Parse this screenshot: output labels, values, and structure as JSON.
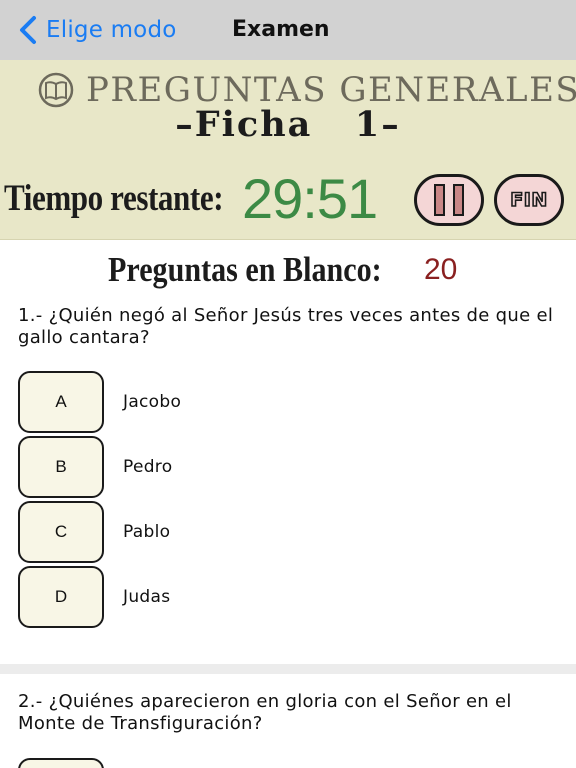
{
  "nav": {
    "back_label": "Elige modo",
    "title": "Examen"
  },
  "header": {
    "section_title": "PREGUNTAS GENERALES",
    "sheet_prefix": "–",
    "sheet_title": "Ficha   1",
    "sheet_suffix": "–",
    "icon": "book-icon"
  },
  "timer": {
    "label": "Tiempo restante:",
    "value": "29:51",
    "pause_icon": "pause-icon",
    "finish_label": "FIN"
  },
  "blank": {
    "label": "Preguntas en Blanco:",
    "count": "20"
  },
  "questions": [
    {
      "text": "1.- ¿Quién negó al Señor Jesús tres veces antes de que el gallo cantara?",
      "options": [
        {
          "letter": "A",
          "text": "Jacobo"
        },
        {
          "letter": "B",
          "text": "Pedro"
        },
        {
          "letter": "C",
          "text": "Pablo"
        },
        {
          "letter": "D",
          "text": "Judas"
        }
      ]
    },
    {
      "text": "2.- ¿Quiénes aparecieron en gloria con el Señor en el Monte de Transfiguración?"
    }
  ],
  "colors": {
    "nav_background": "#d2d2d2",
    "accent_blue": "#1a7cf3",
    "header_background": "#e8e7c8",
    "timer_green": "#3c8a45",
    "count_red": "#8a2020",
    "button_pink": "#f4d6d6"
  }
}
